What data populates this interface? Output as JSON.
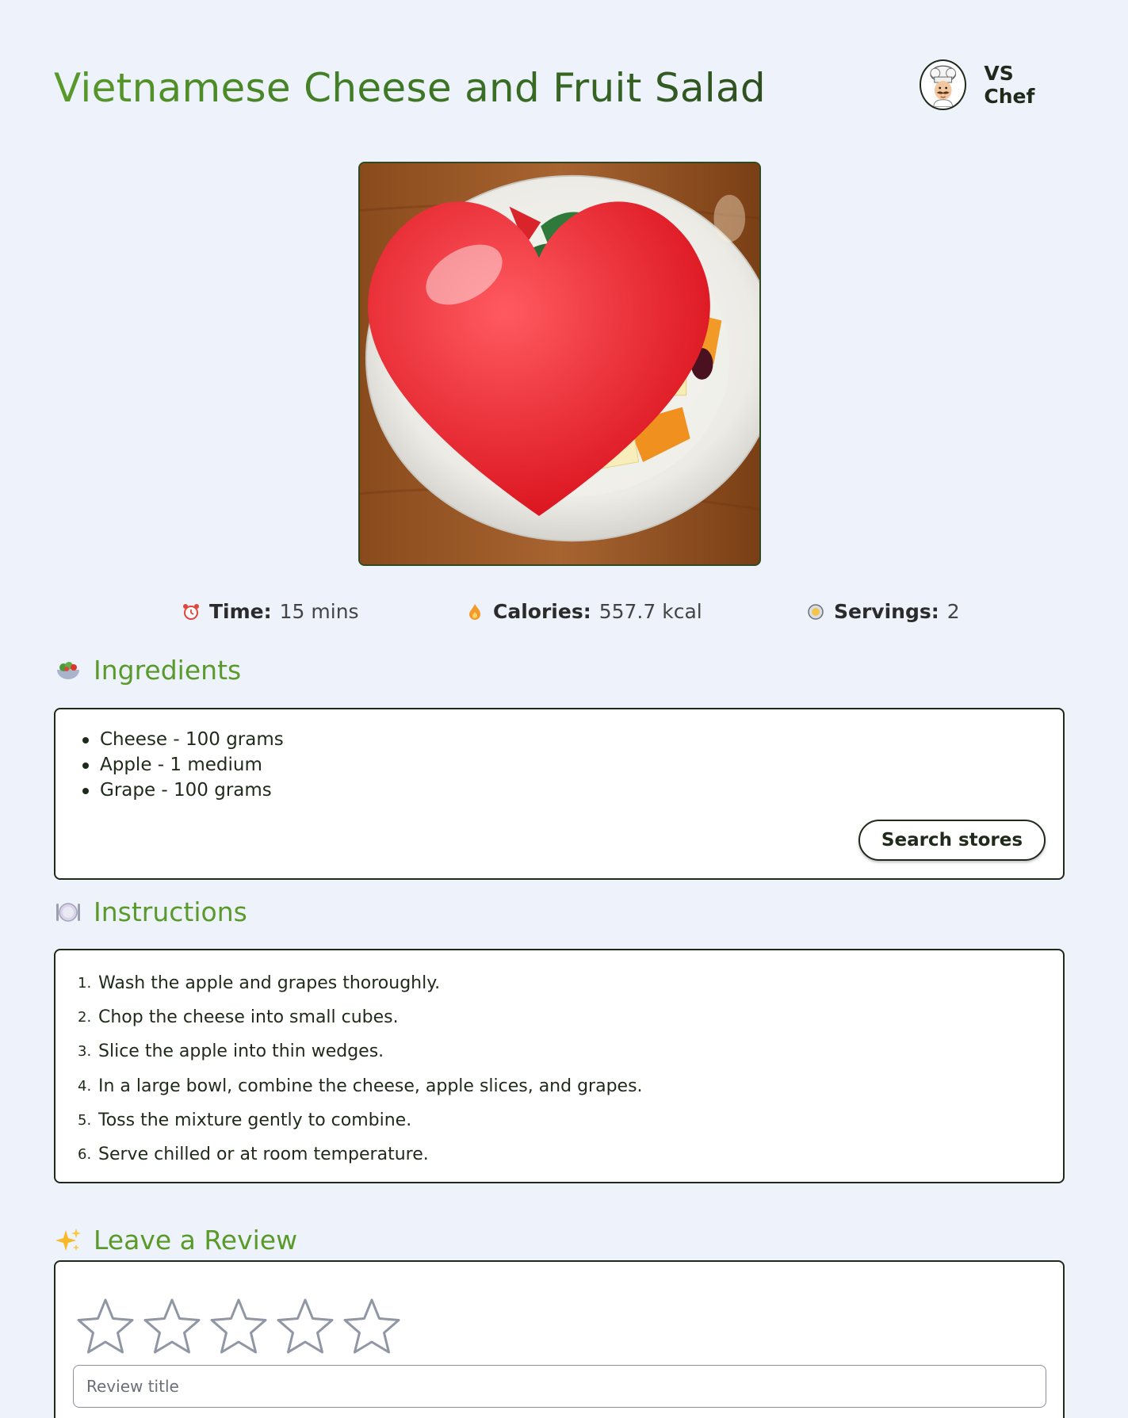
{
  "recipe": {
    "title": "Vietnamese Cheese and Fruit Salad",
    "author": "VS Chef",
    "image_alt": "Vietnamese Cheese and Fruit Salad"
  },
  "stats": {
    "time_label": "Time:",
    "time_value": "15 mins",
    "calories_label": "Calories:",
    "calories_value": "557.7 kcal",
    "servings_label": "Servings:",
    "servings_value": "2"
  },
  "ingredients": {
    "heading": "Ingredients",
    "items": [
      "Cheese - 100 grams",
      "Apple - 1 medium",
      "Grape - 100 grams"
    ],
    "search_button": "Search stores"
  },
  "instructions": {
    "heading": "Instructions",
    "steps": [
      "Wash the apple and grapes thoroughly.",
      "Chop the cheese into small cubes.",
      "Slice the apple into thin wedges.",
      "In a large bowl, combine the cheese, apple slices, and grapes.",
      "Toss the mixture gently to combine.",
      "Serve chilled or at room temperature."
    ],
    "step_numbers": [
      "1.",
      "2.",
      "3.",
      "4.",
      "5.",
      "6."
    ]
  },
  "review": {
    "heading": "Leave a Review",
    "rating": 0,
    "max_rating": 5,
    "title_placeholder": "Review title"
  },
  "colors": {
    "background": "#edf2fb",
    "accent_green": "#5a9a2a",
    "dark": "#1f2a1a",
    "heart": "#e8202a"
  },
  "icons": {
    "time": "alarm-clock-icon",
    "calories": "flame-icon",
    "servings": "plate-icon",
    "ingredients": "salad-bowl-icon",
    "instructions": "plate-cutlery-icon",
    "review": "sparkles-icon",
    "favorite": "heart-icon",
    "rating": "star-icon"
  }
}
